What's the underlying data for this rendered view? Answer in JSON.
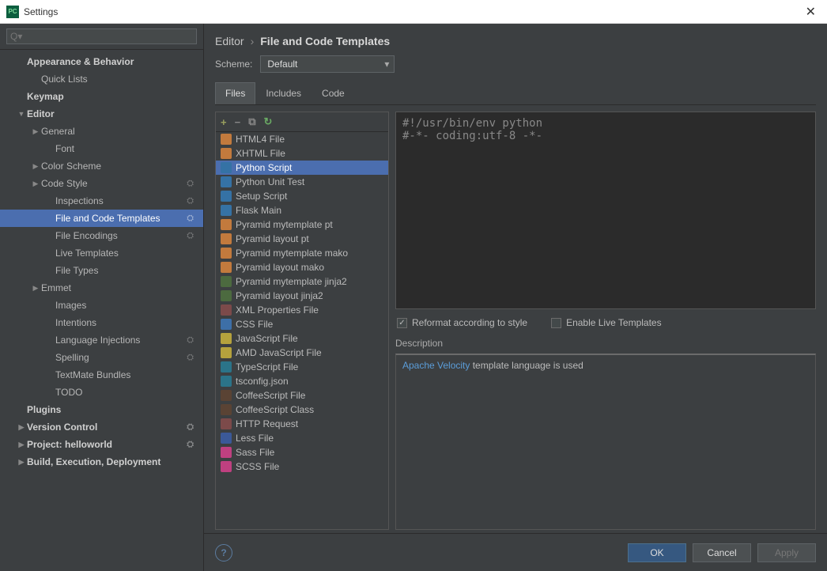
{
  "window": {
    "title": "Settings"
  },
  "search": {
    "placeholder": "Q▾"
  },
  "tree": [
    {
      "label": "Appearance & Behavior",
      "indent": 0,
      "bold": true,
      "arrow": ""
    },
    {
      "label": "Quick Lists",
      "indent": 1
    },
    {
      "label": "Keymap",
      "indent": 0,
      "bold": true
    },
    {
      "label": "Editor",
      "indent": 0,
      "bold": true,
      "arrow": "▼"
    },
    {
      "label": "General",
      "indent": 1,
      "arrow": "▶"
    },
    {
      "label": "Font",
      "indent": 2
    },
    {
      "label": "Color Scheme",
      "indent": 1,
      "arrow": "▶"
    },
    {
      "label": "Code Style",
      "indent": 1,
      "arrow": "▶",
      "gear": true
    },
    {
      "label": "Inspections",
      "indent": 2,
      "gear": true
    },
    {
      "label": "File and Code Templates",
      "indent": 2,
      "gear": true,
      "selected": true
    },
    {
      "label": "File Encodings",
      "indent": 2,
      "gear": true
    },
    {
      "label": "Live Templates",
      "indent": 2
    },
    {
      "label": "File Types",
      "indent": 2
    },
    {
      "label": "Emmet",
      "indent": 1,
      "arrow": "▶"
    },
    {
      "label": "Images",
      "indent": 2
    },
    {
      "label": "Intentions",
      "indent": 2
    },
    {
      "label": "Language Injections",
      "indent": 2,
      "gear": true
    },
    {
      "label": "Spelling",
      "indent": 2,
      "gear": true
    },
    {
      "label": "TextMate Bundles",
      "indent": 2
    },
    {
      "label": "TODO",
      "indent": 2
    },
    {
      "label": "Plugins",
      "indent": 0,
      "bold": true
    },
    {
      "label": "Version Control",
      "indent": 0,
      "bold": true,
      "arrow": "▶",
      "gear": true
    },
    {
      "label": "Project: helloworld",
      "indent": 0,
      "bold": true,
      "arrow": "▶",
      "gear": true
    },
    {
      "label": "Build, Execution, Deployment",
      "indent": 0,
      "bold": true,
      "arrow": "▶"
    }
  ],
  "breadcrumb": {
    "root": "Editor",
    "leaf": "File and Code Templates"
  },
  "scheme": {
    "label": "Scheme:",
    "value": "Default"
  },
  "tabs": [
    {
      "label": "Files",
      "active": true
    },
    {
      "label": "Includes"
    },
    {
      "label": "Code"
    }
  ],
  "templates": [
    {
      "label": "HTML4 File",
      "icon": "html"
    },
    {
      "label": "XHTML File",
      "icon": "html"
    },
    {
      "label": "Python Script",
      "icon": "py",
      "selected": true
    },
    {
      "label": "Python Unit Test",
      "icon": "py"
    },
    {
      "label": "Setup Script",
      "icon": "py"
    },
    {
      "label": "Flask Main",
      "icon": "py"
    },
    {
      "label": "Pyramid mytemplate pt",
      "icon": "html"
    },
    {
      "label": "Pyramid layout pt",
      "icon": "html"
    },
    {
      "label": "Pyramid mytemplate mako",
      "icon": "html"
    },
    {
      "label": "Pyramid layout mako",
      "icon": "html"
    },
    {
      "label": "Pyramid mytemplate jinja2",
      "icon": "jinja"
    },
    {
      "label": "Pyramid layout jinja2",
      "icon": "jinja"
    },
    {
      "label": "XML Properties File",
      "icon": "xml"
    },
    {
      "label": "CSS File",
      "icon": "css"
    },
    {
      "label": "JavaScript File",
      "icon": "js"
    },
    {
      "label": "AMD JavaScript File",
      "icon": "js"
    },
    {
      "label": "TypeScript File",
      "icon": "ts"
    },
    {
      "label": "tsconfig.json",
      "icon": "ts"
    },
    {
      "label": "CoffeeScript File",
      "icon": "coffee"
    },
    {
      "label": "CoffeeScript Class",
      "icon": "coffee"
    },
    {
      "label": "HTTP Request",
      "icon": "xml"
    },
    {
      "label": "Less File",
      "icon": "less"
    },
    {
      "label": "Sass File",
      "icon": "sass"
    },
    {
      "label": "SCSS File",
      "icon": "sass"
    }
  ],
  "code": "#!/usr/bin/env python\n#-*- coding:utf-8 -*-",
  "checks": {
    "reformat": {
      "label": "Reformat according to style",
      "checked": true
    },
    "livetmpl": {
      "label": "Enable Live Templates",
      "checked": false
    }
  },
  "description": {
    "label": "Description",
    "link": "Apache Velocity",
    "tail": " template language is used"
  },
  "buttons": {
    "ok": "OK",
    "cancel": "Cancel",
    "apply": "Apply",
    "help": "?"
  }
}
